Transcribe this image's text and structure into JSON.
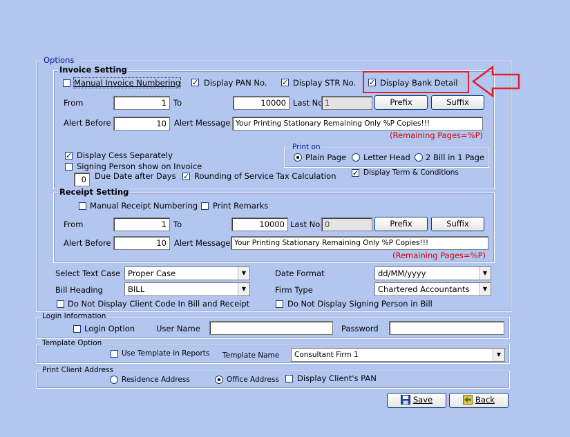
{
  "options": {
    "legend": "Options"
  },
  "invoice": {
    "legend": "Invoice Setting",
    "manual_numbering": "Manual Invoice Numbering",
    "display_pan": "Display PAN No.",
    "display_str": "Display STR No.",
    "display_bank": "Display Bank Detail",
    "from_label": "From",
    "from_value": "1",
    "to_label": "To",
    "to_value": "10000",
    "lastno_label": "Last No",
    "lastno_value": "1",
    "prefix": "Prefix",
    "suffix": "Suffix",
    "alert_before_label": "Alert Before",
    "alert_before_value": "10",
    "alert_msg_label": "Alert Message",
    "alert_msg_value": "Your Printing Stationary Remaining Only %P Copies!!!",
    "remaining_hint": "(Remaining Pages=%P)",
    "display_cess": "Display Cess Separately",
    "signing_person": "Signing Person show on Invoice",
    "due_days_value": "0",
    "due_date_label": "Due Date after Days",
    "rounding": "Rounding of Service Tax Calculation",
    "print_on_legend": "Print on",
    "plain_page": "Plain Page",
    "letter_head": "Letter Head",
    "two_bill": "2 Bill in 1 Page",
    "display_terms": "Display Term & Conditions"
  },
  "receipt": {
    "legend": "Receipt Setting",
    "manual_numbering": "Manual Receipt Numbering",
    "print_remarks": "Print Remarks",
    "from_label": "From",
    "from_value": "1",
    "to_label": "To",
    "to_value": "10000",
    "lastno_label": "Last No",
    "lastno_value": "0",
    "prefix": "Prefix",
    "suffix": "Suffix",
    "alert_before_label": "Alert Before",
    "alert_before_value": "10",
    "alert_msg_label": "Alert Message",
    "alert_msg_value": "Your Printing Stationary Remaining Only %P Copies!!!",
    "remaining_hint": "(Remaining Pages=%P)"
  },
  "general": {
    "text_case_label": "Select Text Case",
    "text_case_value": "Proper Case",
    "date_format_label": "Date Format",
    "date_format_value": "dd/MM/yyyy",
    "bill_heading_label": "Bill Heading",
    "bill_heading_value": "BILL",
    "firm_type_label": "Firm Type",
    "firm_type_value": "Chartered Accountants",
    "no_client_code": "Do Not Display Client Code In Bill and Receipt",
    "no_signing_person": "Do Not Display Signing Person in Bill"
  },
  "login": {
    "legend": "Login Information",
    "login_option": "Login Option",
    "user_name_label": "User Name",
    "password_label": "Password"
  },
  "template": {
    "legend": "Template Option",
    "use_template": "Use Template in Reports",
    "template_name_label": "Template Name",
    "template_name_value": "Consultant Firm 1"
  },
  "client_address": {
    "legend": "Print Client Address",
    "residence": "Residence Address",
    "office": "Office Address",
    "display_pan": "Display Client's PAN"
  },
  "buttons": {
    "save": "Save",
    "back": "Back"
  },
  "colors": {
    "background": "#b3c6f0",
    "highlight": "#e0202a",
    "legend_blue": "#0a1a9a"
  }
}
